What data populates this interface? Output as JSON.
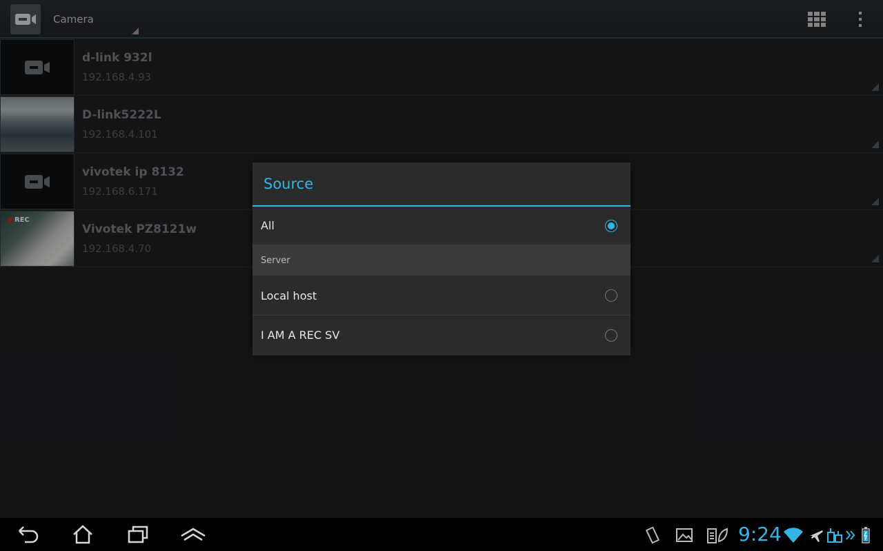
{
  "actionbar": {
    "app_icon": "video-camera-icon",
    "spinner_label": "Camera",
    "grid_icon": "grid-view-icon",
    "overflow_icon": "overflow-menu-icon"
  },
  "cameras": [
    {
      "name": "d-link 932l",
      "ip": "192.168.4.93",
      "thumb": "placeholder"
    },
    {
      "name": "D-link5222L",
      "ip": "192.168.4.101",
      "thumb": "office"
    },
    {
      "name": "vivotek ip 8132",
      "ip": "192.168.6.171",
      "thumb": "placeholder"
    },
    {
      "name": "Vivotek PZ8121w",
      "ip": "192.168.4.70",
      "thumb": "rec",
      "rec_label": "REC"
    }
  ],
  "dialog": {
    "title": "Source",
    "all_label": "All",
    "all_selected": true,
    "section_label": "Server",
    "servers": [
      {
        "label": "Local host",
        "selected": false
      },
      {
        "label": "I AM A REC SV",
        "selected": false
      }
    ]
  },
  "sysbar": {
    "clock": "9:24",
    "nav_icons": [
      "back-icon",
      "home-icon",
      "recent-apps-icon",
      "menu-up-icon"
    ],
    "tray_icons": [
      "rotation-lock-icon",
      "gallery-icon",
      "battery-saver-icon",
      "wifi-icon",
      "airplane-icon",
      "usb-icon",
      "chevron-icon",
      "battery-icon"
    ],
    "accent": "#33b5e5"
  }
}
